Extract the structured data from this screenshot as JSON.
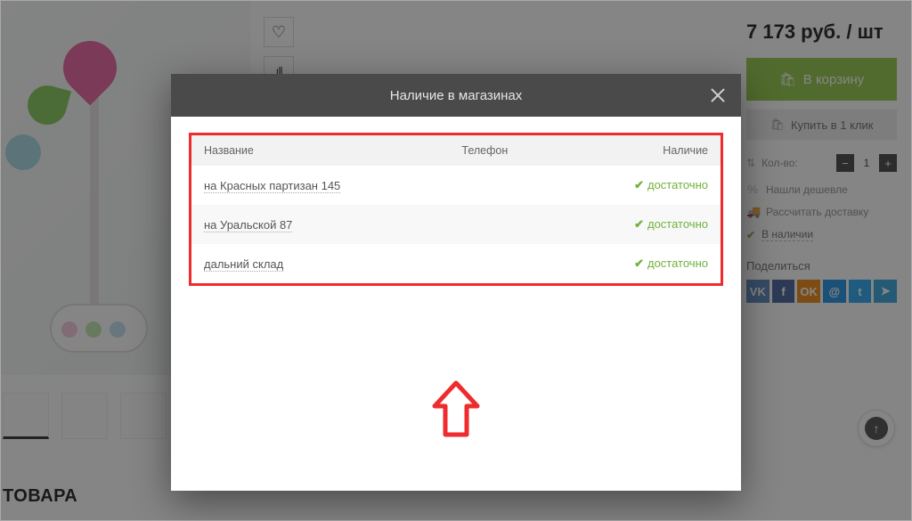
{
  "product": {
    "price_text": "7 173 руб. / шт",
    "cart_btn": "В корзину",
    "oneclick_btn": "Купить в 1 клик",
    "qty_label": "Кол-во:",
    "qty_value": "1",
    "cheaper_link": "Нашли дешевле",
    "delivery_link": "Рассчитать доставку",
    "stock_label": "В наличии",
    "share_label": "Поделиться"
  },
  "section_heading": "ТОВАРА",
  "modal": {
    "title": "Наличие в магазинах",
    "headers": {
      "name": "Название",
      "phone": "Телефон",
      "avail": "Наличие"
    },
    "rows": [
      {
        "name": "на Красных партизан 145",
        "phone": "",
        "avail": "достаточно"
      },
      {
        "name": "на Уральской 87",
        "phone": "",
        "avail": "достаточно"
      },
      {
        "name": "дальний склад",
        "phone": "",
        "avail": "достаточно"
      }
    ]
  },
  "share_icons": [
    "VK",
    "f",
    "OK",
    "@",
    "t",
    "➤"
  ]
}
